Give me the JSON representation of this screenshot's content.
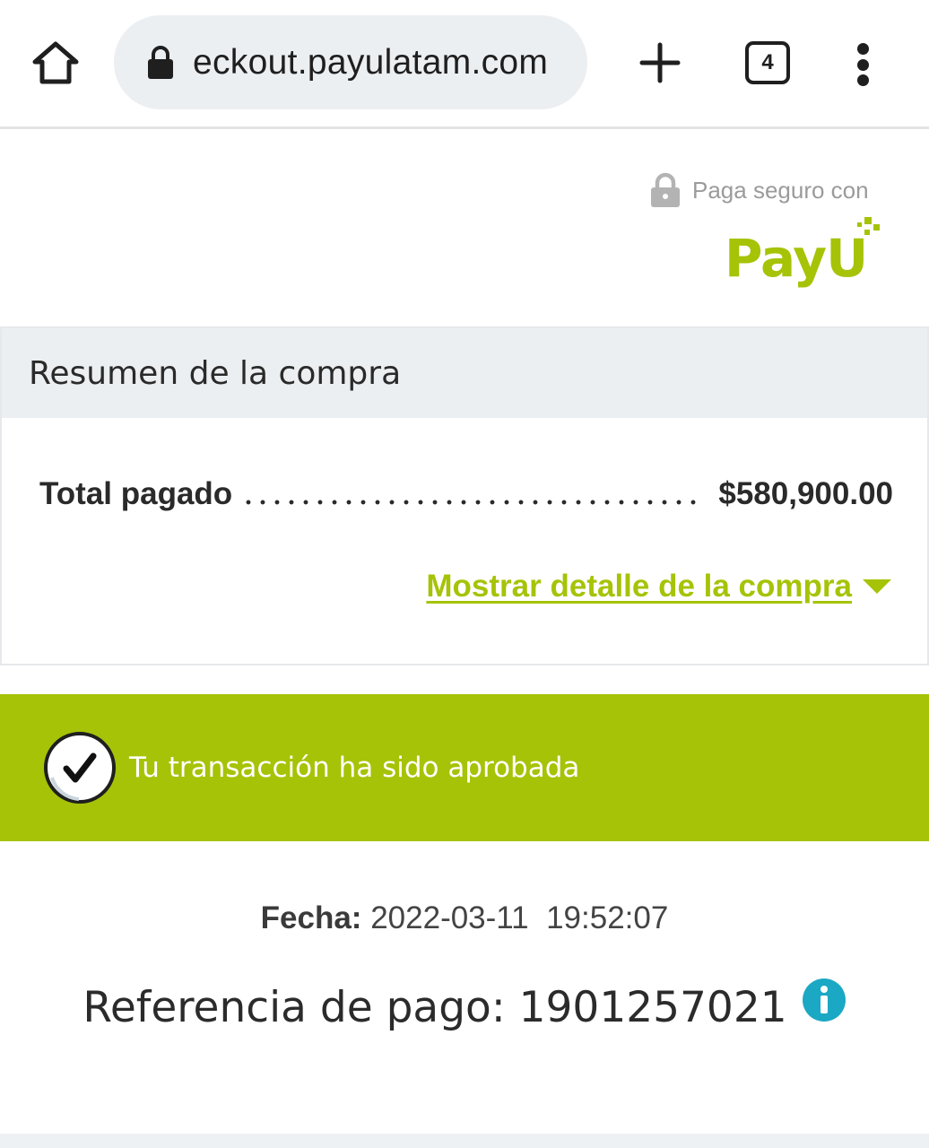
{
  "browser": {
    "url": "eckout.payulatam.com",
    "tab_count": "4"
  },
  "header": {
    "secure_label": "Paga seguro con",
    "logo_text": "PayU",
    "brand_color": "#a6c307"
  },
  "summary": {
    "title": "Resumen de la compra",
    "total_label": "Total pagado",
    "total_value": "$580,900.00",
    "detail_link": "Mostrar detalle de la compra"
  },
  "status": {
    "message": "Tu transacción ha sido aprobada"
  },
  "details": {
    "date_label": "Fecha:",
    "date_value": "2022-03-11  19:52:07",
    "reference_label": "Referencia de pago:",
    "reference_value": "1901257021"
  },
  "icons": {
    "home": "home-icon",
    "lock": "lock-icon",
    "new_tab": "plus-icon",
    "menu": "more-vert-icon",
    "check": "check-circle-icon",
    "info": "info-icon",
    "caret": "caret-down-icon"
  }
}
